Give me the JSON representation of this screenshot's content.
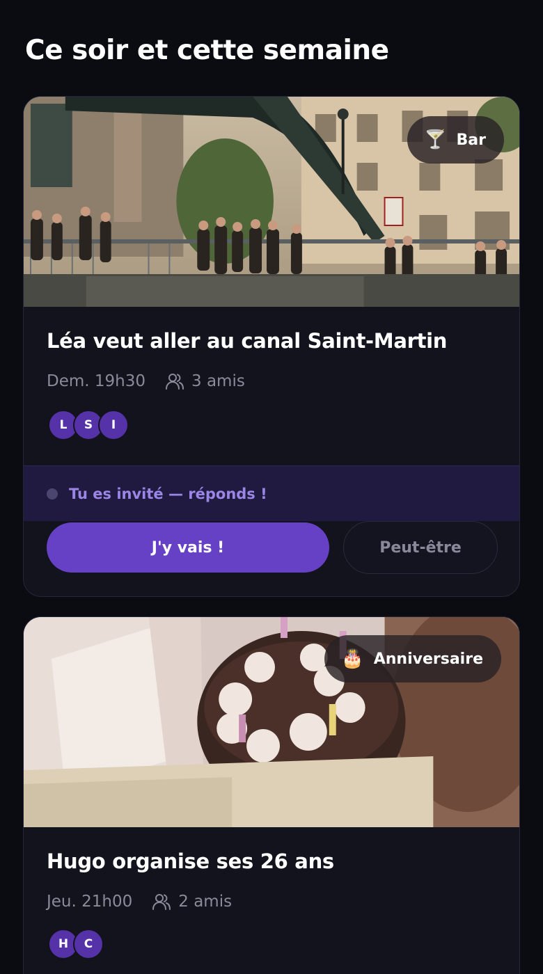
{
  "section": {
    "title": "Ce soir et cette semaine"
  },
  "events": [
    {
      "tag_label": "Bar",
      "tag_icon": "🍸",
      "title": "Léa veut aller au canal Saint-Martin",
      "when": "Dem. 19h30",
      "friends": "3 amis",
      "avatars": [
        "L",
        "S",
        "I"
      ],
      "invite_text": "Tu es invité — réponds !",
      "primary_label": "J'y vais !",
      "secondary_label": "Peut-être"
    },
    {
      "tag_label": "Anniversaire",
      "tag_icon": "🎂",
      "title": "Hugo organise ses 26 ans",
      "when": "Jeu. 21h00",
      "friends": "2 amis",
      "avatars": [
        "H",
        "C"
      ]
    }
  ],
  "colors": {
    "background": "#0b0b12",
    "card": "#13131d",
    "accent": "#6641c6",
    "avatar": "#5532a8",
    "invite_banner": "#211a40",
    "invite_text": "#9b86e6"
  }
}
